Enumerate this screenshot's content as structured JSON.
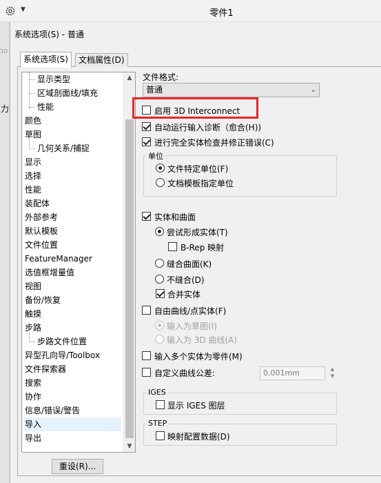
{
  "window": {
    "title": "零件1"
  },
  "dialog": {
    "title": "系统选项(S) - 普通",
    "tabs": [
      "系统选项(S)",
      "文档属性(D)"
    ]
  },
  "tree": {
    "items": [
      "显示类型",
      "区域剖面线/填充",
      "性能",
      "颜色",
      "草图",
      "几何关系/捕捉",
      "显示",
      "选择",
      "性能",
      "装配体",
      "外部参考",
      "默认模板",
      "文件位置",
      "FeatureManager",
      "选值框增量值",
      "视图",
      "备份/恢复",
      "触摸",
      "步路",
      "步路文件位置",
      "异型孔向导/Toolbox",
      "文件探索器",
      "搜索",
      "协作",
      "信息/错误/警告",
      "导入",
      "导出"
    ],
    "selected": "导入"
  },
  "reset_button": "重设(R)...",
  "file_format": {
    "label": "文件格式:",
    "value": "普通"
  },
  "options": {
    "enable_3d_interconnect": "启用 3D Interconnect",
    "auto_diagnose": "自动运行输入诊断（愈合(H))",
    "full_check": "进行完全实体检查并修正错误(C)",
    "units_group": "单位",
    "units_file_specific": "文件特定单位(F)",
    "units_template": "文档模板指定单位",
    "solid_surface": "实体和曲面",
    "try_form_solid": "尝试形成实体(T)",
    "brep_mapping": "B-Rep 映射",
    "knit_surfaces": "缝合曲面(K)",
    "no_knit": "不缝合(D)",
    "merge_entities": "合并实体",
    "free_curves": "自由曲线/点实体(F)",
    "import_as_sketch": "输入为草图(I)",
    "import_as_3d_curves": "输入为 3D 曲线(A)",
    "import_multiple_parts": "输入多个实体为零件(M)",
    "custom_tolerance": "自定义曲线公差:",
    "tolerance_value": "0.001mm",
    "iges_group": "IGES",
    "show_iges_layers": "显示 IGES 图层",
    "step_group": "STEP",
    "map_config_data": "映射配置数据(D)"
  },
  "colors": {
    "highlight": "#ee2222",
    "tree_selected": "#e5f1fb"
  },
  "icons": {
    "settings": "gear-icon",
    "dropdown": "chevron-down-icon"
  }
}
